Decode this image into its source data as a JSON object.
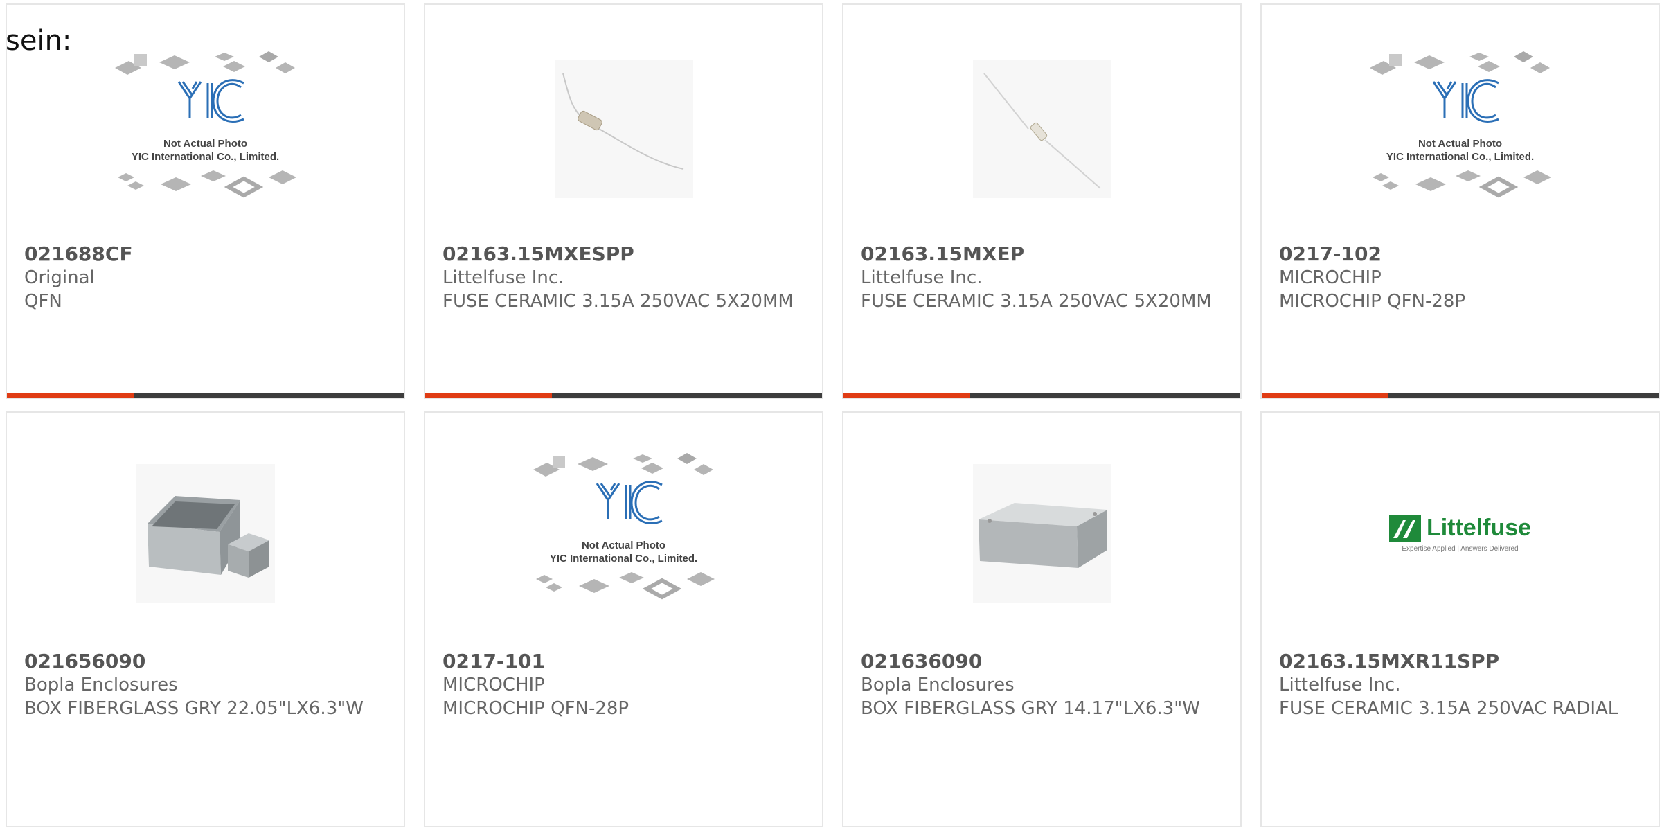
{
  "page": {
    "label": "sein:"
  },
  "colors": {
    "accent": "#e03c14",
    "bar": "#3d3d3d",
    "border": "#e6e6e6",
    "logo_green": "#1f8a3a",
    "yic_blue": "#2b6fb6"
  },
  "placeholder": {
    "line1": "Not Actual Photo",
    "line2": "YIC International Co., Limited.",
    "logo_text": "YIC"
  },
  "littelfuse_logo": {
    "brand": "Littelfuse",
    "tagline": "Expertise Applied | Answers Delivered"
  },
  "products": [
    {
      "part_number": "021688CF",
      "manufacturer": "Original",
      "description": "QFN",
      "image": "placeholder-icon"
    },
    {
      "part_number": "02163.15MXESPP",
      "manufacturer": "Littelfuse Inc.",
      "description": "FUSE CERAMIC 3.15A 250VAC 5X20MM",
      "image": "fuse-photo"
    },
    {
      "part_number": "02163.15MXEP",
      "manufacturer": "Littelfuse Inc.",
      "description": "FUSE CERAMIC 3.15A 250VAC 5X20MM",
      "image": "fuse-photo"
    },
    {
      "part_number": "0217-102",
      "manufacturer": "MICROCHIP",
      "description": "MICROCHIP QFN-28P",
      "image": "placeholder-icon"
    },
    {
      "part_number": "021656090",
      "manufacturer": "Bopla Enclosures",
      "description": "BOX FIBERGLASS GRY 22.05\"LX6.3\"W",
      "image": "enclosure-photo"
    },
    {
      "part_number": "0217-101",
      "manufacturer": "MICROCHIP",
      "description": "MICROCHIP QFN-28P",
      "image": "placeholder-icon"
    },
    {
      "part_number": "021636090",
      "manufacturer": "Bopla Enclosures",
      "description": "BOX FIBERGLASS GRY 14.17\"LX6.3\"W",
      "image": "enclosure-photo"
    },
    {
      "part_number": "02163.15MXR11SPP",
      "manufacturer": "Littelfuse Inc.",
      "description": "FUSE CERAMIC 3.15A 250VAC RADIAL",
      "image": "littelfuse-logo"
    }
  ]
}
